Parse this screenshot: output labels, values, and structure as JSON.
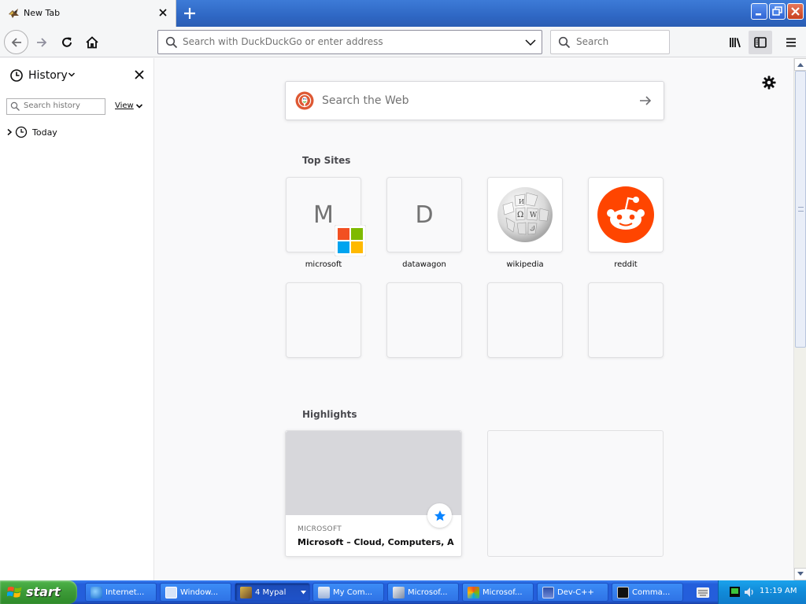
{
  "browser": {
    "tab": {
      "title": "New Tab"
    },
    "urlbar": {
      "placeholder": "Search with DuckDuckGo or enter address"
    },
    "searchbar": {
      "placeholder": "Search"
    }
  },
  "sidebar": {
    "title": "History",
    "search_placeholder": "Search history",
    "view_label": "View",
    "groups": [
      {
        "label": "Today"
      }
    ]
  },
  "newtab": {
    "web_search_placeholder": "Search the Web",
    "topsites_title": "Top Sites",
    "topsites": [
      {
        "label": "microsoft",
        "letter": "M",
        "icon": "microsoft-logo"
      },
      {
        "label": "datawagon",
        "letter": "D",
        "icon": "none"
      },
      {
        "label": "wikipedia",
        "icon": "wikipedia-globe"
      },
      {
        "label": "reddit",
        "icon": "reddit-alien"
      }
    ],
    "highlights_title": "Highlights",
    "highlights": [
      {
        "source": "MICROSOFT",
        "title": "Microsoft – Cloud, Computers, A...",
        "icon": "bookmark-star"
      }
    ]
  },
  "taskbar": {
    "start_label": "start",
    "tasks": [
      {
        "label": "Internet...",
        "icon": "ie-icon"
      },
      {
        "label": "Window...",
        "icon": "window-icon"
      },
      {
        "label": "4 Mypal",
        "icon": "mypal-icon"
      },
      {
        "label": "My Com...",
        "icon": "computer-icon"
      },
      {
        "label": "Microsof...",
        "icon": "word-icon"
      },
      {
        "label": "Microsof...",
        "icon": "paint-icon"
      },
      {
        "label": "Dev-C++",
        "icon": "devcpp-icon"
      },
      {
        "label": "Comma...",
        "icon": "cmd-icon"
      }
    ],
    "clock": "11:19 AM"
  },
  "colors": {
    "accent": "#0a84ff",
    "xp_blue": "#245edb",
    "start_green": "#3c9a37",
    "reddit": "#ff4500",
    "ddg": "#de5833"
  }
}
